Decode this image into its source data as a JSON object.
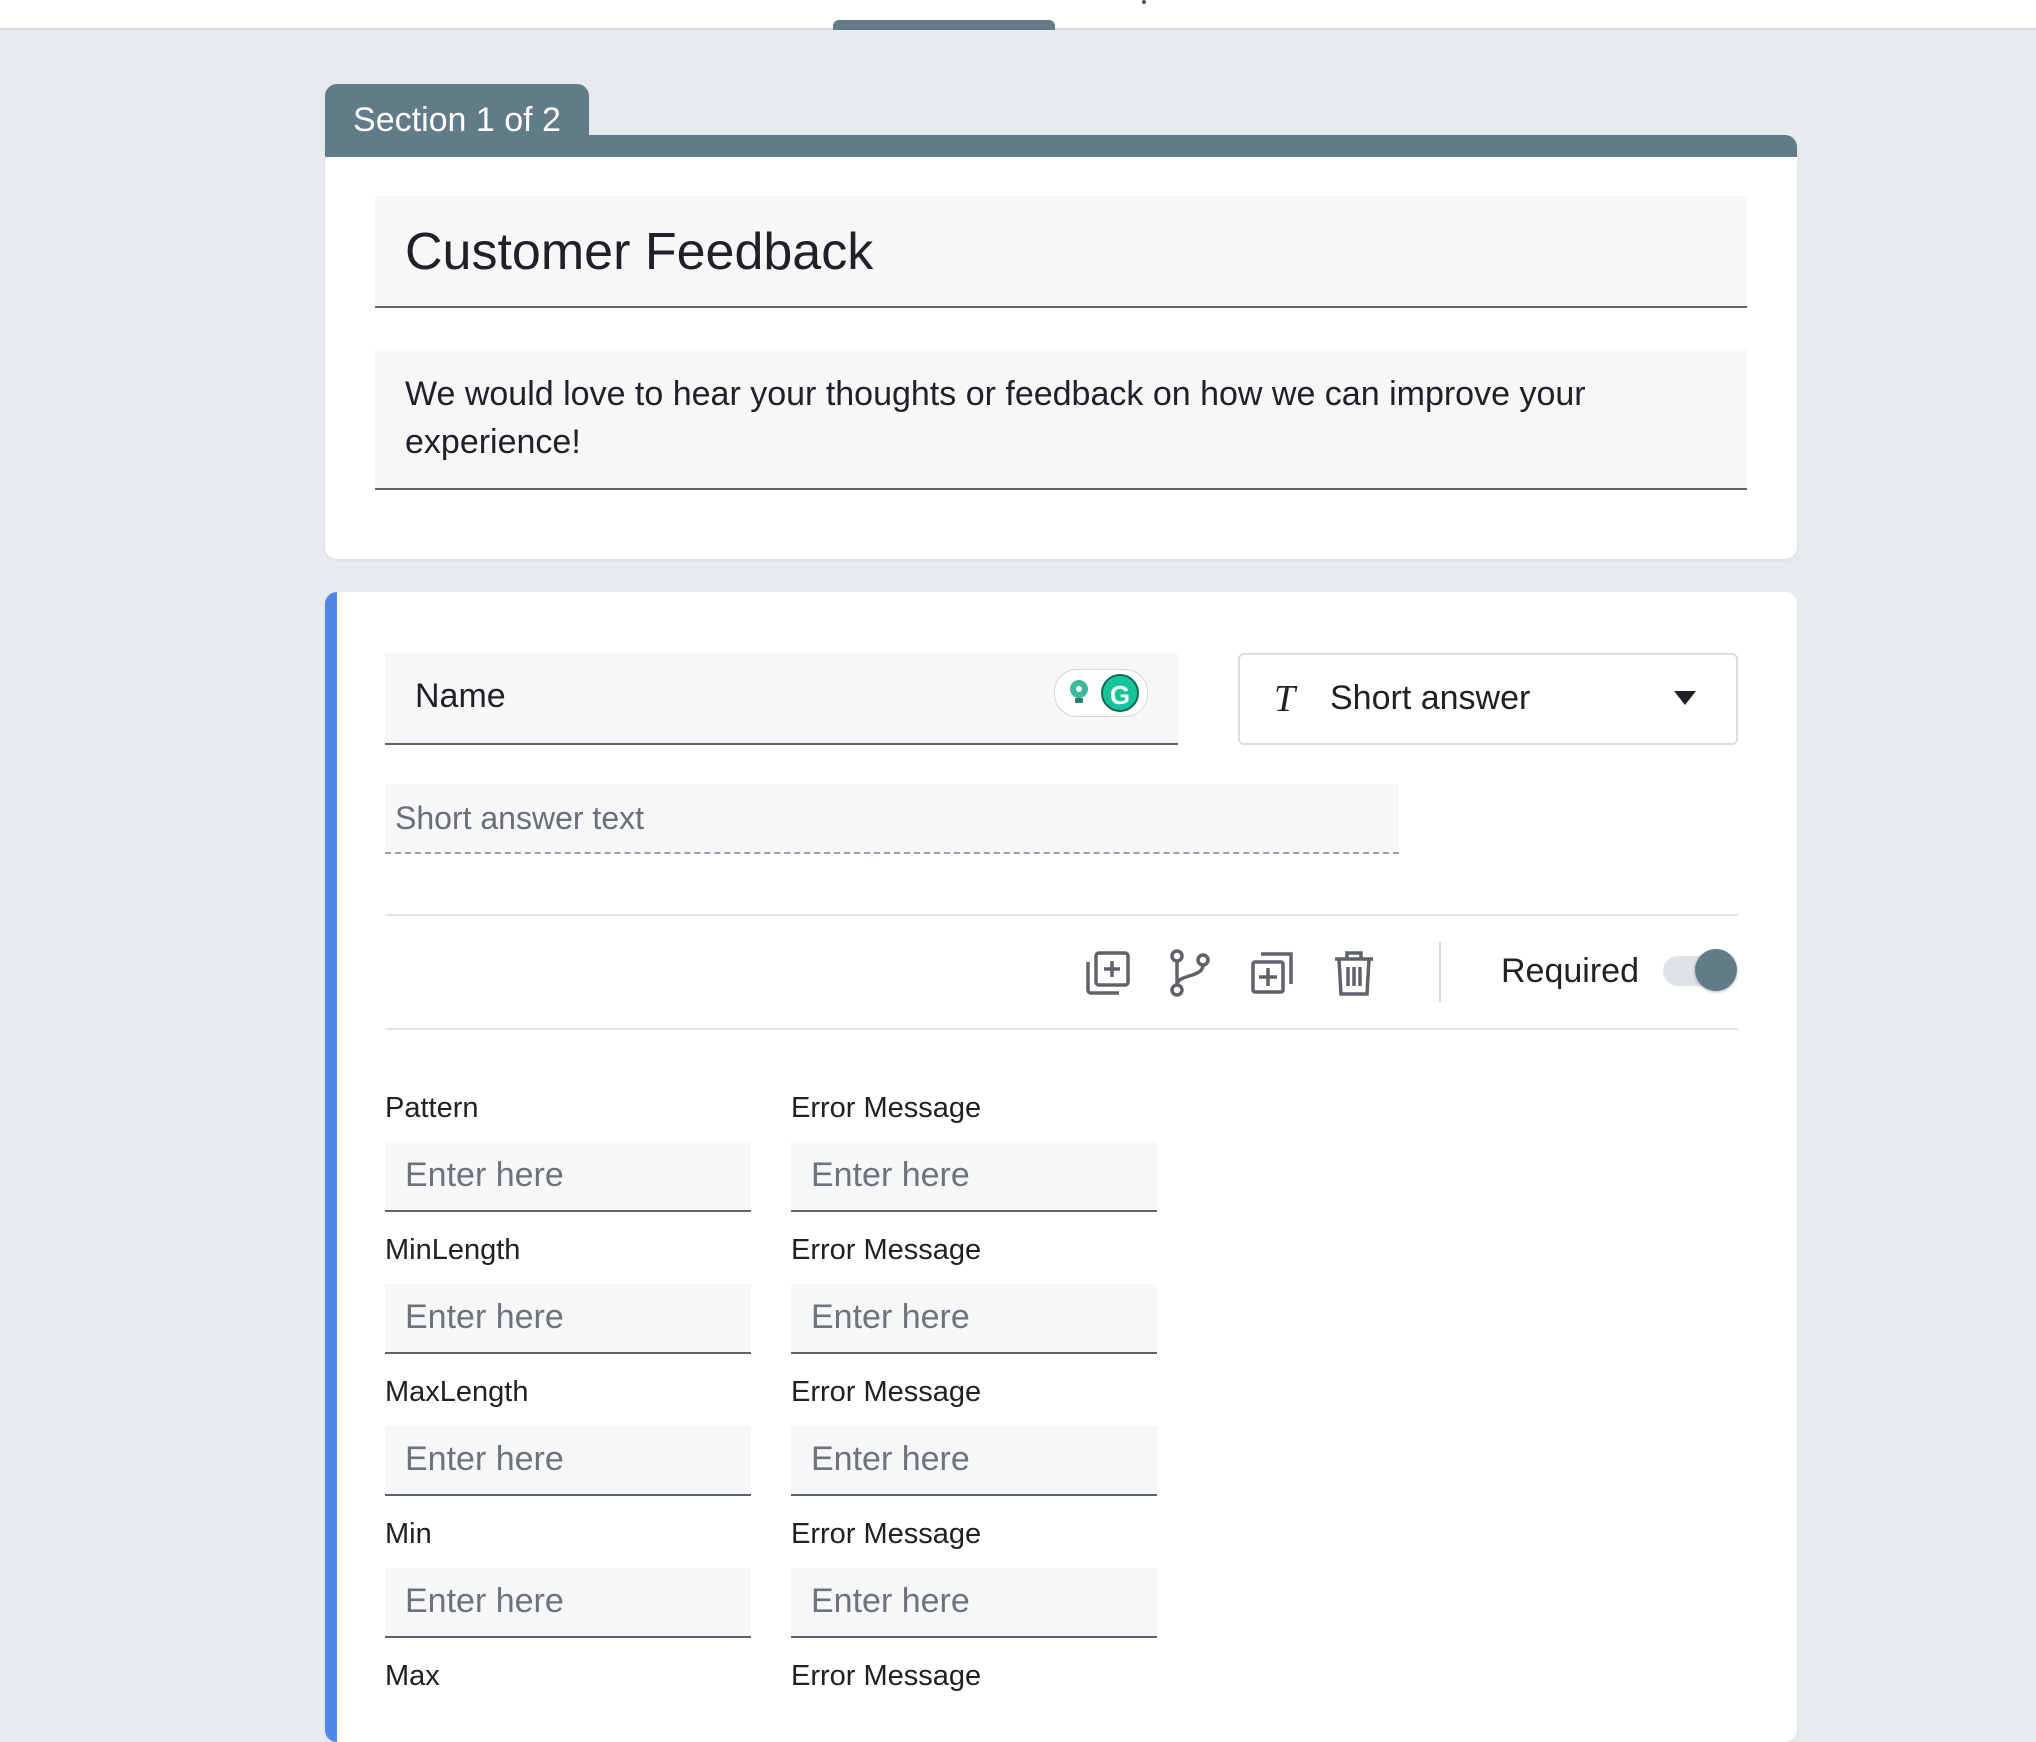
{
  "section": {
    "tab_label": "Section 1 of 2"
  },
  "form": {
    "title": "Customer Feedback",
    "description": "We would love to hear your thoughts or feedback on how we can improve your experience!"
  },
  "question": {
    "title": "Name",
    "type_label": "Short answer",
    "answer_placeholder": "Short answer text",
    "required_label": "Required",
    "required": true
  },
  "validation": {
    "input_placeholder": "Enter here",
    "rows": [
      {
        "label": "Pattern",
        "error_label": "Error Message"
      },
      {
        "label": "MinLength",
        "error_label": "Error Message"
      },
      {
        "label": "MaxLength",
        "error_label": "Error Message"
      },
      {
        "label": "Min",
        "error_label": "Error Message"
      },
      {
        "label": "Max",
        "error_label": "Error Message"
      }
    ]
  },
  "colors": {
    "accent": "#4f86e8",
    "section": "#617b89",
    "grammarly": "#15c39a"
  }
}
